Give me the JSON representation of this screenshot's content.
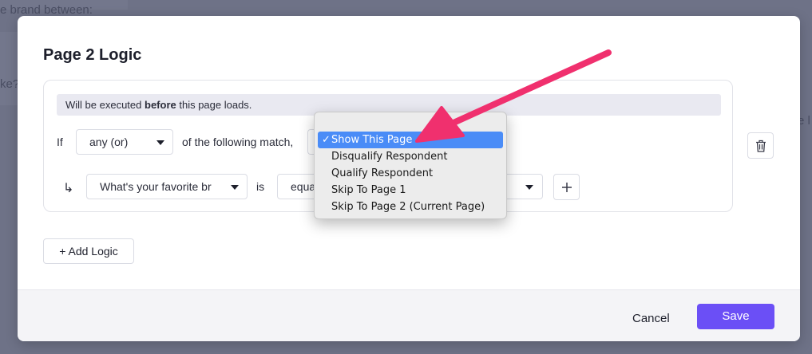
{
  "background": {
    "fragment_top": "e brand between:",
    "fragment_left": "ke?",
    "fragment_right": "e l"
  },
  "modal": {
    "title": "Page 2 Logic",
    "banner": {
      "prefix": "Will be executed ",
      "bold": "before",
      "suffix": " this page loads."
    },
    "condition": {
      "if_label": "If",
      "match_select": "any (or)",
      "match_suffix": "of the following match,"
    },
    "rule": {
      "arrow_glyph": "↳",
      "question_select": "What's your favorite brand",
      "is_label": "is",
      "operator_select": "equa",
      "add_icon": "plus-icon"
    },
    "delete_icon": "trash-icon",
    "add_logic_label": "+ Add Logic",
    "footer": {
      "cancel_label": "Cancel",
      "save_label": "Save"
    }
  },
  "dropdown": {
    "selected_index": 0,
    "check_glyph": "✓",
    "options": [
      "Show This Page",
      "Disqualify Respondent",
      "Qualify Respondent",
      "Skip To Page 1",
      "Skip To Page 2 (Current Page)"
    ]
  },
  "colors": {
    "accent": "#6b4ff6",
    "highlight": "#4a8cf7",
    "annotation_arrow": "#f0306e"
  }
}
